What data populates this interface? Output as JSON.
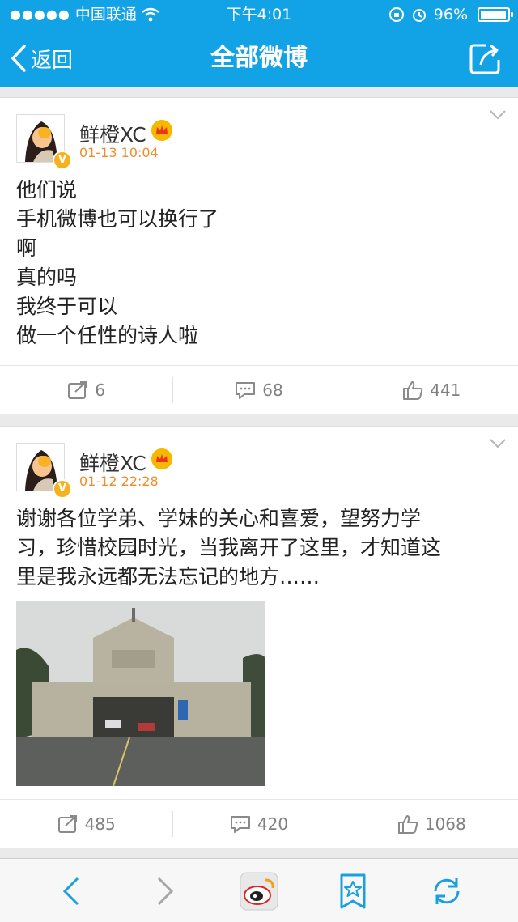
{
  "status_bar": {
    "signal_dots": "●●●●●",
    "carrier": "中国联通",
    "time": "下午4:01",
    "battery": "96%",
    "battery_level": 0.96
  },
  "nav": {
    "back_label": "返回",
    "title": "全部微博",
    "accent_color": "#11a3e6"
  },
  "posts": [
    {
      "user": "鲜橙XC",
      "time": "01-13 10:04",
      "verified_badge": "V",
      "text": "他们说\n手机微博也可以换行了\n啊\n真的吗\n我终于可以\n做一个任性的诗人啦",
      "reposts": "6",
      "comments": "68",
      "likes": "441"
    },
    {
      "user": "鲜橙XC",
      "time": "01-12 22:28",
      "verified_badge": "V",
      "text": "谢谢各位学弟、学妹的关心和喜爱，望努力学\n习，珍惜校园时光，当我离开了这里，才知道这\n里是我永远都无法忘记的地方……",
      "reposts": "485",
      "comments": "420",
      "likes": "1068"
    }
  ],
  "toolbar": {
    "icons": [
      "back-arrow-icon",
      "forward-arrow-icon",
      "weibo-logo-icon",
      "favorite-star-icon",
      "refresh-icon"
    ]
  }
}
